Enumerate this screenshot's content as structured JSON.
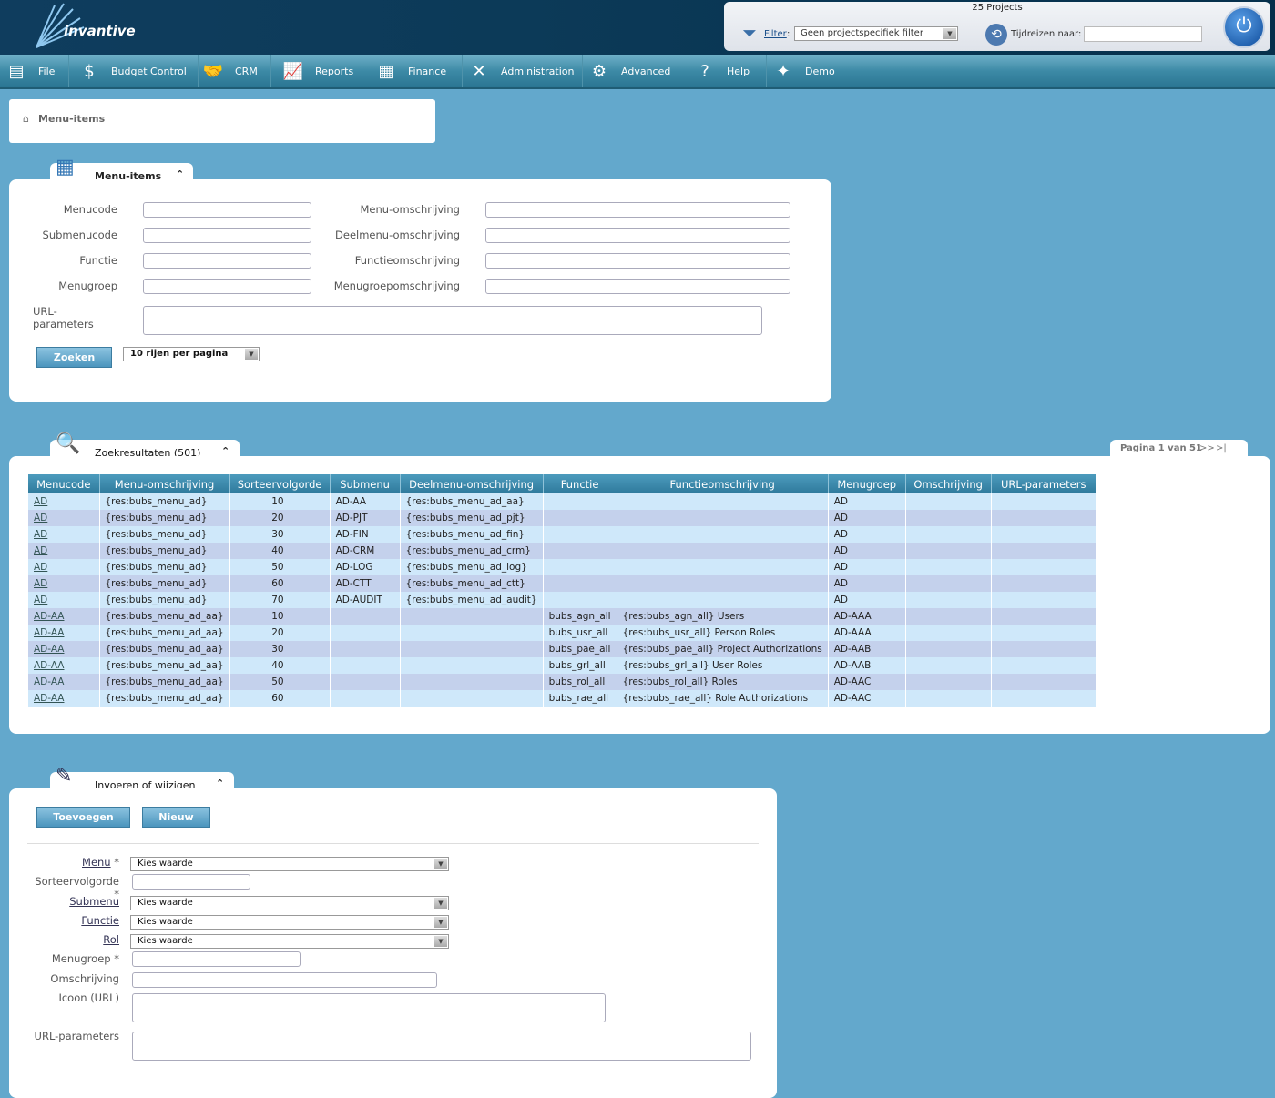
{
  "header": {
    "logo_text": "invantive",
    "projects_count": "25 Projects",
    "filter_label": "Filter",
    "filter_value": "Geen projectspecifiek filter",
    "timetravel_label": "Tijdreizen naar:",
    "timetravel_value": ""
  },
  "nav": [
    {
      "label": "File",
      "icon": "server-icon"
    },
    {
      "label": "Budget Control",
      "icon": "money-bag-icon"
    },
    {
      "label": "CRM",
      "icon": "handshake-icon"
    },
    {
      "label": "Reports",
      "icon": "presentation-icon"
    },
    {
      "label": "Finance",
      "icon": "calculator-icon"
    },
    {
      "label": "Administration",
      "icon": "tools-icon"
    },
    {
      "label": "Advanced",
      "icon": "gears-icon"
    },
    {
      "label": "Help",
      "icon": "question-icon"
    },
    {
      "label": "Demo",
      "icon": "logo-icon"
    }
  ],
  "breadcrumb": {
    "label": "Menu-items"
  },
  "search": {
    "title": "Menu-items",
    "labels": {
      "menucode": "Menucode",
      "submenucode": "Submenucode",
      "functie": "Functie",
      "menugroep": "Menugroep",
      "url": "URL-parameters",
      "menu_omschr": "Menu-omschrijving",
      "deelmenu_omschr": "Deelmenu-omschrijving",
      "functie_omschr": "Functieomschrijving",
      "menugroep_omschr": "Menugroepomschrijving"
    },
    "search_button": "Zoeken",
    "rows_per_page": "10 rijen per pagina"
  },
  "results": {
    "title": "Zoekresultaten (501)",
    "pagination": "Pagina 1 van 51",
    "next": ">>",
    "last": ">|",
    "columns": [
      "Menucode",
      "Menu-omschrijving",
      "Sorteervolgorde",
      "Submenu",
      "Deelmenu-omschrijving",
      "Functie",
      "Functieomschrijving",
      "Menugroep",
      "Omschrijving",
      "URL-parameters"
    ],
    "rows": [
      [
        "AD",
        "{res:bubs_menu_ad}",
        "10",
        "AD-AA",
        "{res:bubs_menu_ad_aa}",
        "",
        "",
        "AD",
        "",
        ""
      ],
      [
        "AD",
        "{res:bubs_menu_ad}",
        "20",
        "AD-PJT",
        "{res:bubs_menu_ad_pjt}",
        "",
        "",
        "AD",
        "",
        ""
      ],
      [
        "AD",
        "{res:bubs_menu_ad}",
        "30",
        "AD-FIN",
        "{res:bubs_menu_ad_fin}",
        "",
        "",
        "AD",
        "",
        ""
      ],
      [
        "AD",
        "{res:bubs_menu_ad}",
        "40",
        "AD-CRM",
        "{res:bubs_menu_ad_crm}",
        "",
        "",
        "AD",
        "",
        ""
      ],
      [
        "AD",
        "{res:bubs_menu_ad}",
        "50",
        "AD-LOG",
        "{res:bubs_menu_ad_log}",
        "",
        "",
        "AD",
        "",
        ""
      ],
      [
        "AD",
        "{res:bubs_menu_ad}",
        "60",
        "AD-CTT",
        "{res:bubs_menu_ad_ctt}",
        "",
        "",
        "AD",
        "",
        ""
      ],
      [
        "AD",
        "{res:bubs_menu_ad}",
        "70",
        "AD-AUDIT",
        "{res:bubs_menu_ad_audit}",
        "",
        "",
        "AD",
        "",
        ""
      ],
      [
        "AD-AA",
        "{res:bubs_menu_ad_aa}",
        "10",
        "",
        "",
        "bubs_agn_all",
        "{res:bubs_agn_all} Users",
        "AD-AAA",
        "",
        ""
      ],
      [
        "AD-AA",
        "{res:bubs_menu_ad_aa}",
        "20",
        "",
        "",
        "bubs_usr_all",
        "{res:bubs_usr_all} Person Roles",
        "AD-AAA",
        "",
        ""
      ],
      [
        "AD-AA",
        "{res:bubs_menu_ad_aa}",
        "30",
        "",
        "",
        "bubs_pae_all",
        "{res:bubs_pae_all} Project Authorizations",
        "AD-AAB",
        "",
        ""
      ],
      [
        "AD-AA",
        "{res:bubs_menu_ad_aa}",
        "40",
        "",
        "",
        "bubs_grl_all",
        "{res:bubs_grl_all} User Roles",
        "AD-AAB",
        "",
        ""
      ],
      [
        "AD-AA",
        "{res:bubs_menu_ad_aa}",
        "50",
        "",
        "",
        "bubs_rol_all",
        "{res:bubs_rol_all} Roles",
        "AD-AAC",
        "",
        ""
      ],
      [
        "AD-AA",
        "{res:bubs_menu_ad_aa}",
        "60",
        "",
        "",
        "bubs_rae_all",
        "{res:bubs_rae_all} Role Authorizations",
        "AD-AAC",
        "",
        ""
      ]
    ]
  },
  "edit": {
    "title": "Invoeren of wijzigen",
    "add_button": "Toevoegen",
    "new_button": "Nieuw",
    "fields": {
      "menu": "Menu",
      "sorteer": "Sorteervolgorde",
      "submenu": "Submenu",
      "functie": "Functie",
      "rol": "Rol",
      "menugroep": "Menugroep",
      "omschrijving": "Omschrijving",
      "icoon": "Icoon (URL)",
      "url": "URL-parameters"
    },
    "required_mark": "*",
    "select_placeholder": "Kies waarde"
  }
}
